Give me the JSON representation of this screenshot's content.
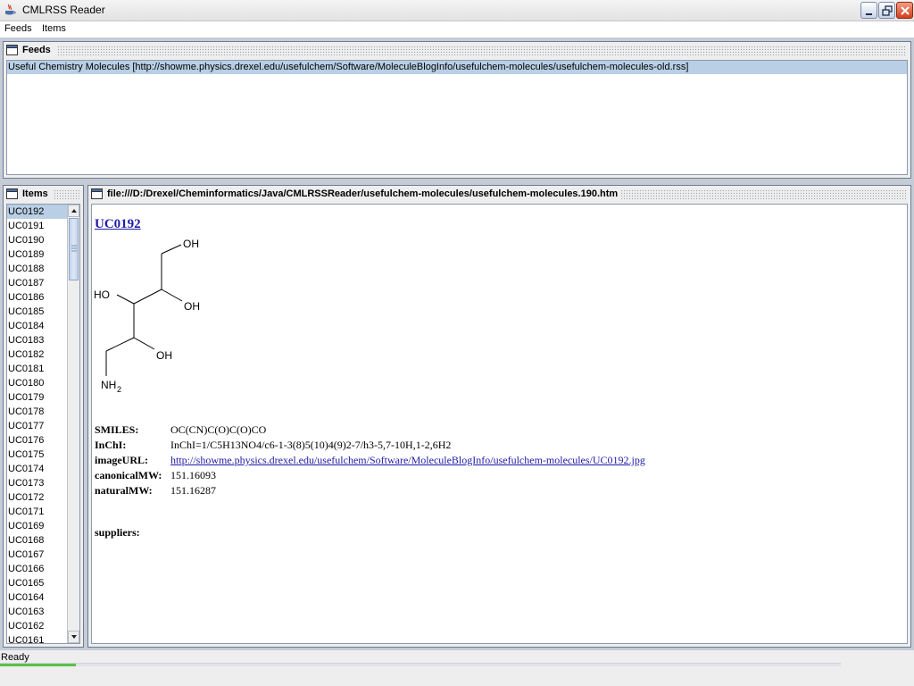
{
  "window": {
    "title": "CMLRSS Reader",
    "controls": [
      "minimize-icon",
      "restore-icon",
      "close-icon"
    ]
  },
  "menu": {
    "feeds": "Feeds",
    "items": "Items"
  },
  "feeds_frame": {
    "title": "Feeds",
    "rows": [
      "Useful Chemistry Molecules [http://showme.physics.drexel.edu/usefulchem/Software/MoleculeBlogInfo/usefulchem-molecules/usefulchem-molecules-old.rss]"
    ]
  },
  "items_frame": {
    "title": "Items",
    "items": [
      "UC0192",
      "UC0191",
      "UC0190",
      "UC0189",
      "UC0188",
      "UC0187",
      "UC0186",
      "UC0185",
      "UC0184",
      "UC0183",
      "UC0182",
      "UC0181",
      "UC0180",
      "UC0179",
      "UC0178",
      "UC0177",
      "UC0176",
      "UC0175",
      "UC0174",
      "UC0173",
      "UC0172",
      "UC0171",
      "UC0169",
      "UC0168",
      "UC0167",
      "UC0166",
      "UC0165",
      "UC0164",
      "UC0163",
      "UC0162",
      "UC0161"
    ],
    "selected_index": 0
  },
  "detail_frame": {
    "title": "file:///D:/Drexel/Cheminformatics/Java/CMLRSSReader/usefulchem-molecules/usefulchem-molecules.190.htm",
    "heading": "UC0192",
    "molecule_labels": {
      "oh1": "OH",
      "ho": "HO",
      "oh2": "OH",
      "oh3": "OH",
      "nh2": "NH",
      "nh2_sub": "2"
    },
    "props": {
      "smiles_label": "SMILES:",
      "smiles": "OC(CN)C(O)C(O)CO",
      "inchi_label": "InChI:",
      "inchi": "InChI=1/C5H13NO4/c6-1-3(8)5(10)4(9)2-7/h3-5,7-10H,1-2,6H2",
      "imageurl_label": "imageURL:",
      "imageurl": "http://showme.physics.drexel.edu/usefulchem/Software/MoleculeBlogInfo/usefulchem-molecules/UC0192.jpg",
      "canonicalmw_label": "canonicalMW:",
      "canonicalmw": "151.16093",
      "naturalmw_label": "naturalMW:",
      "naturalmw": "151.16287",
      "suppliers_label": "suppliers:"
    }
  },
  "status": {
    "text": "Ready",
    "progress": 0.09
  },
  "colors": {
    "selection": "#b8cfe5",
    "link": "#1f1aa6",
    "desktop": "#c6ccd6"
  }
}
